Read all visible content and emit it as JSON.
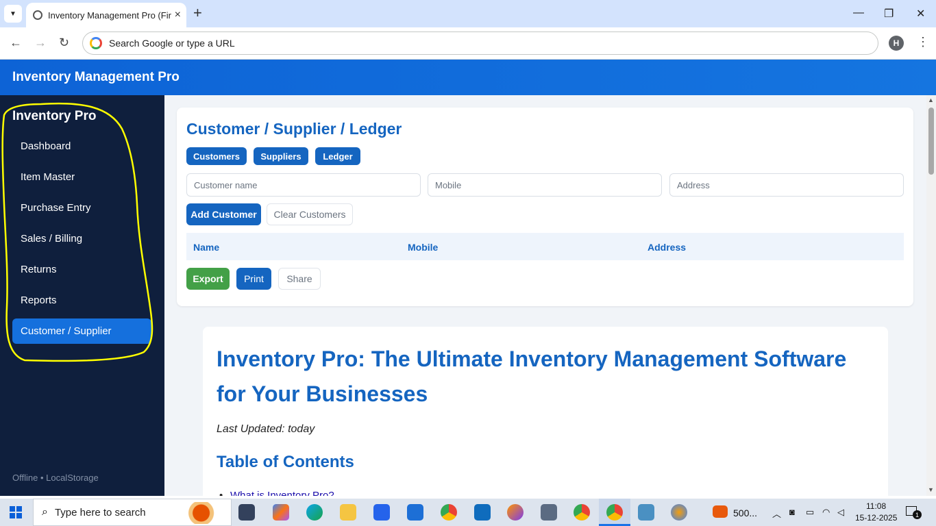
{
  "browser": {
    "tab_title": "Inventory Management Pro (Fir",
    "omnibox_placeholder": "Search Google or type a URL",
    "profile_initial": "H"
  },
  "app": {
    "header_title": "Inventory Management Pro"
  },
  "sidebar": {
    "brand": "Inventory Pro",
    "items": [
      {
        "label": "Dashboard"
      },
      {
        "label": "Item Master"
      },
      {
        "label": "Purchase Entry"
      },
      {
        "label": "Sales / Billing"
      },
      {
        "label": "Returns"
      },
      {
        "label": "Reports"
      },
      {
        "label": "Customer / Supplier",
        "active": true
      }
    ],
    "footer": "Offline • LocalStorage"
  },
  "panel": {
    "title": "Customer / Supplier / Ledger",
    "tabs": [
      "Customers",
      "Suppliers",
      "Ledger"
    ],
    "fields": {
      "name_placeholder": "Customer name",
      "mobile_placeholder": "Mobile",
      "address_placeholder": "Address"
    },
    "add_button": "Add Customer",
    "clear_button": "Clear Customers",
    "columns": [
      "Name",
      "Mobile",
      "Address"
    ],
    "export_button": "Export",
    "print_button": "Print",
    "share_button": "Share"
  },
  "article": {
    "title": "Inventory Pro: The Ultimate Inventory Management Software for Your Businesses",
    "updated": "Last Updated: today",
    "toc_heading": "Table of Contents",
    "toc_first_link": "What is Inventory Pro?"
  },
  "taskbar": {
    "search_placeholder": "Type here to search",
    "tray_app_label": "500...",
    "time": "11:08",
    "date": "15-12-2025",
    "notification_count": "1"
  },
  "colors": {
    "primary": "#1565c0",
    "sidebar_bg": "#0f1f3d",
    "export_green": "#43a047",
    "annotation_yellow": "#ffff00"
  }
}
